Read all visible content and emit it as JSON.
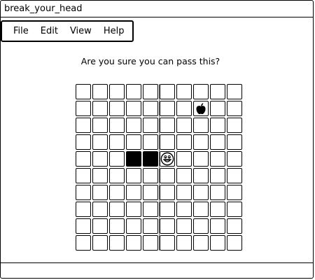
{
  "window": {
    "title": "break_your_head"
  },
  "menu": {
    "items": [
      {
        "label": "File"
      },
      {
        "label": "Edit"
      },
      {
        "label": "View"
      },
      {
        "label": "Help"
      }
    ]
  },
  "game": {
    "prompt": "Are you sure you can pass this?",
    "grid": {
      "rows": 10,
      "cols": 10
    },
    "snake": {
      "head": {
        "row": 4,
        "col": 5,
        "icon": "smiley-face-icon"
      },
      "body": [
        {
          "row": 4,
          "col": 3
        },
        {
          "row": 4,
          "col": 4
        }
      ]
    },
    "apple": {
      "row": 1,
      "col": 7,
      "icon": "apple-icon"
    }
  }
}
